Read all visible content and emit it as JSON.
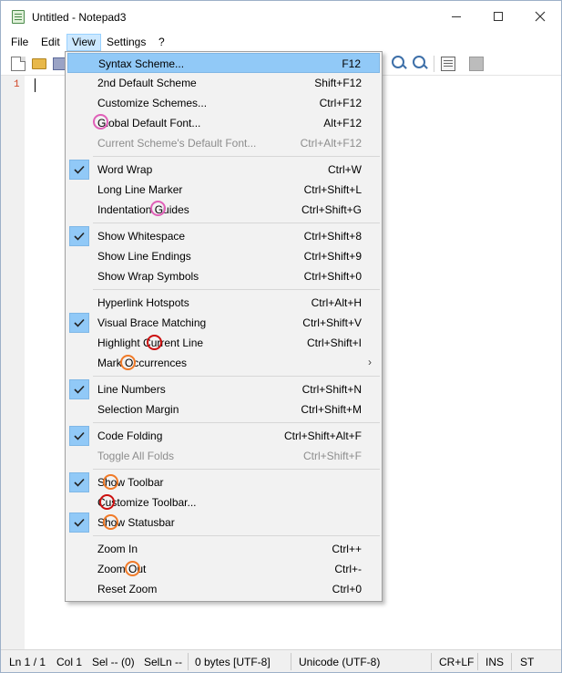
{
  "window": {
    "title": "Untitled - Notepad3"
  },
  "menubar": [
    {
      "label": "File"
    },
    {
      "label": "Edit"
    },
    {
      "label": "View"
    },
    {
      "label": "Settings"
    },
    {
      "label": "?"
    }
  ],
  "editor": {
    "line_number": "1"
  },
  "view_menu": [
    {
      "label": "Syntax Scheme...",
      "shortcut": "F12",
      "highlighted": true
    },
    {
      "label": "2nd Default Scheme",
      "shortcut": "Shift+F12"
    },
    {
      "label": "Customize Schemes...",
      "shortcut": "Ctrl+F12"
    },
    {
      "label": "Global Default Font...",
      "shortcut": "Alt+F12"
    },
    {
      "label": "Current Scheme's Default Font...",
      "shortcut": "Ctrl+Alt+F12",
      "disabled": true
    },
    {
      "label": "Word Wrap",
      "shortcut": "Ctrl+W",
      "checked": true
    },
    {
      "label": "Long Line Marker",
      "shortcut": "Ctrl+Shift+L"
    },
    {
      "label": "Indentation Guides",
      "shortcut": "Ctrl+Shift+G"
    },
    {
      "label": "Show Whitespace",
      "shortcut": "Ctrl+Shift+8",
      "checked": true
    },
    {
      "label": "Show Line Endings",
      "shortcut": "Ctrl+Shift+9"
    },
    {
      "label": "Show Wrap Symbols",
      "shortcut": "Ctrl+Shift+0"
    },
    {
      "label": "Hyperlink Hotspots",
      "shortcut": "Ctrl+Alt+H"
    },
    {
      "label": "Visual Brace Matching",
      "shortcut": "Ctrl+Shift+V",
      "checked": true
    },
    {
      "label": "Highlight Current Line",
      "shortcut": "Ctrl+Shift+I"
    },
    {
      "label": "Mark Occurrences",
      "shortcut": "",
      "submenu": true
    },
    {
      "label": "Line Numbers",
      "shortcut": "Ctrl+Shift+N",
      "checked": true
    },
    {
      "label": "Selection Margin",
      "shortcut": "Ctrl+Shift+M"
    },
    {
      "label": "Code Folding",
      "shortcut": "Ctrl+Shift+Alt+F",
      "checked": true
    },
    {
      "label": "Toggle All Folds",
      "shortcut": "Ctrl+Shift+F",
      "disabled": true
    },
    {
      "label": "Show Toolbar",
      "shortcut": "",
      "checked": true
    },
    {
      "label": "Customize Toolbar...",
      "shortcut": ""
    },
    {
      "label": "Show Statusbar",
      "shortcut": "",
      "checked": true
    },
    {
      "label": "Zoom In",
      "shortcut": "Ctrl++"
    },
    {
      "label": "Zoom Out",
      "shortcut": "Ctrl+-"
    },
    {
      "label": "Reset Zoom",
      "shortcut": "Ctrl+0"
    }
  ],
  "statusbar": {
    "position": "Ln 1 / 1",
    "column": "Col 1",
    "selection": "Sel -- (0)",
    "sel_lines": "SelLn --",
    "size": "0 bytes [UTF-8]",
    "encoding": "Unicode (UTF-8)",
    "eol": "CR+LF",
    "ins": "INS",
    "st": "ST"
  },
  "colors": {
    "menu_highlight": "#91c9f7",
    "line_number": "#d04020",
    "mark_pink": "#e060b8",
    "mark_orange": "#f07a28",
    "mark_red": "#cc1010"
  },
  "icons": {
    "toolbar": [
      "new-file-icon",
      "open-folder-icon",
      "save-icon",
      "zoom-in-icon",
      "zoom-out-icon",
      "scheme-icon",
      "customize-icon"
    ],
    "check": "checkmark-icon",
    "submenu": "chevron-right-icon"
  }
}
